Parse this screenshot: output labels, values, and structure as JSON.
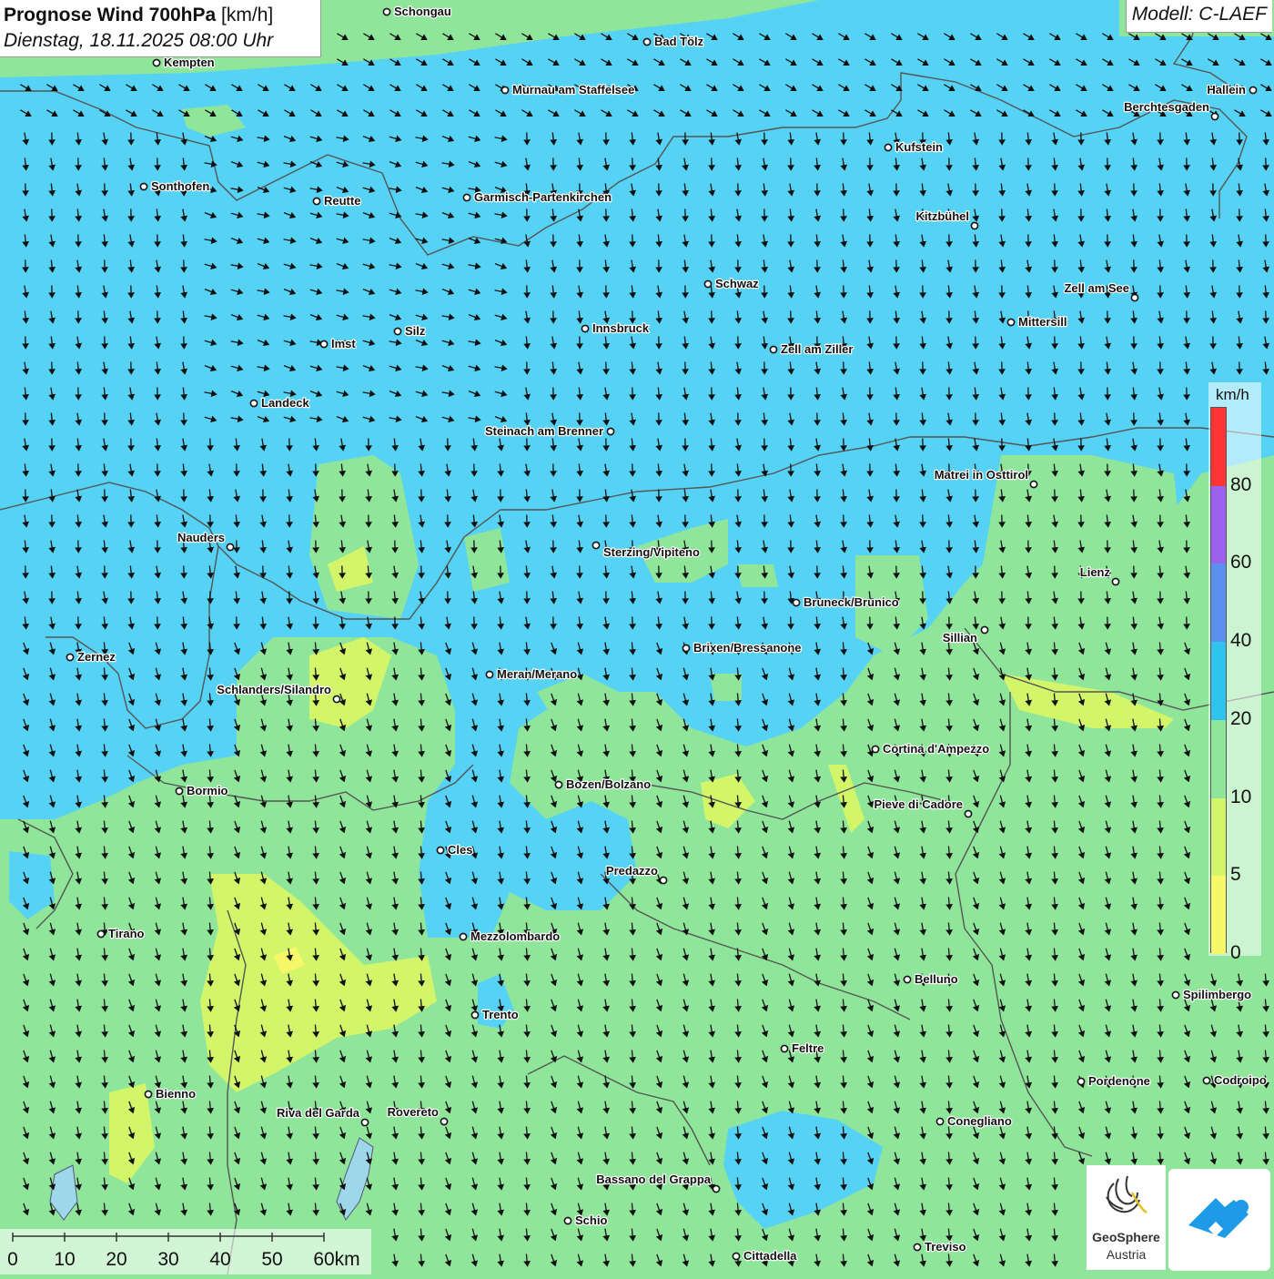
{
  "header": {
    "title": "Prognose Wind 700hPa",
    "unit_bracket": "[km/h]",
    "datetime": "Dienstag, 18.11.2025 08:00 Uhr"
  },
  "model_label": "Modell: C-LAEF",
  "legend": {
    "unit": "km/h",
    "steps": [
      {
        "from": 0,
        "to": 5,
        "color": "#f7f76a"
      },
      {
        "from": 5,
        "to": 10,
        "color": "#d2f56a"
      },
      {
        "from": 10,
        "to": 20,
        "color": "#8fe69a"
      },
      {
        "from": 20,
        "to": 40,
        "color": "#2fc4ee"
      },
      {
        "from": 40,
        "to": 60,
        "color": "#5c90ee"
      },
      {
        "from": 60,
        "to": 80,
        "color": "#9b62ec"
      },
      {
        "from": 80,
        "to": 100,
        "color": "#ff3434"
      }
    ],
    "labels": [
      "0",
      "5",
      "10",
      "20",
      "40",
      "60",
      "80"
    ]
  },
  "scalebar": {
    "ticks": [
      "0",
      "10",
      "20",
      "30",
      "40",
      "50",
      "60km"
    ]
  },
  "cities": [
    {
      "name": "Schongau"
    },
    {
      "name": "Bad Tölz"
    },
    {
      "name": "Kempten"
    },
    {
      "name": "Murnau am Staffelsee"
    },
    {
      "name": "Hallein"
    },
    {
      "name": "Berchtesgaden"
    },
    {
      "name": "Kufstein"
    },
    {
      "name": "Sonthofen"
    },
    {
      "name": "Reutte"
    },
    {
      "name": "Garmisch-Partenkirchen"
    },
    {
      "name": "Kitzbühel"
    },
    {
      "name": "Schwaz"
    },
    {
      "name": "Zell am See"
    },
    {
      "name": "Innsbruck"
    },
    {
      "name": "Mittersill"
    },
    {
      "name": "Silz"
    },
    {
      "name": "Imst"
    },
    {
      "name": "Zell am Ziller"
    },
    {
      "name": "Landeck"
    },
    {
      "name": "Steinach am Brenner"
    },
    {
      "name": "Matrei in Osttirol"
    },
    {
      "name": "Nauders"
    },
    {
      "name": "Sterzing/Vipiteno"
    },
    {
      "name": "Lienz"
    },
    {
      "name": "Bruneck/Brunico"
    },
    {
      "name": "Sillian"
    },
    {
      "name": "Brixen/Bressanone"
    },
    {
      "name": "Zernez"
    },
    {
      "name": "Meran/Merano"
    },
    {
      "name": "Schlanders/Silandro"
    },
    {
      "name": "Cortina d'Ampezzo"
    },
    {
      "name": "Bozen/Bolzano"
    },
    {
      "name": "Bormio"
    },
    {
      "name": "Pieve di Cadore"
    },
    {
      "name": "Cles"
    },
    {
      "name": "Predazzo"
    },
    {
      "name": "Tirano"
    },
    {
      "name": "Mezzolombardo"
    },
    {
      "name": "Belluno"
    },
    {
      "name": "Spilimbergo"
    },
    {
      "name": "Trento"
    },
    {
      "name": "Feltre"
    },
    {
      "name": "Pordenone"
    },
    {
      "name": "Codroipo"
    },
    {
      "name": "Bienno"
    },
    {
      "name": "Riva del Garda"
    },
    {
      "name": "Rovereto"
    },
    {
      "name": "Conegliano"
    },
    {
      "name": "Bassano del Grappa"
    },
    {
      "name": "Schio"
    },
    {
      "name": "Treviso"
    },
    {
      "name": "Cittadella"
    }
  ],
  "logos": {
    "geosphere_name": "GeoSphere",
    "geosphere_sub": "Austria"
  },
  "colors": {
    "wind_10_20": "#8fe69a",
    "wind_20_40": "#2fc4ee",
    "wind_5_10": "#d2f56a",
    "wind_0_5": "#f7f76a",
    "app_logo": "#1e9be6"
  }
}
